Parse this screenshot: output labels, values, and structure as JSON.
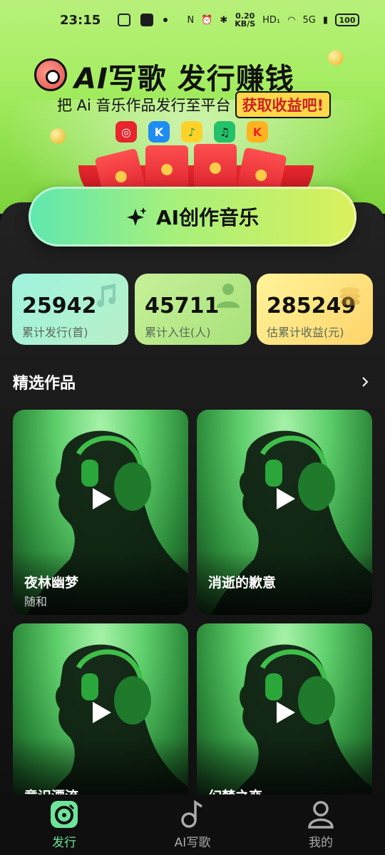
{
  "status_bar": {
    "time": "23:15",
    "speed_value": "0.20",
    "speed_unit": "KB/S",
    "hd": "HD₁",
    "network": "5G",
    "battery": "100"
  },
  "hero": {
    "title_ai": "AI",
    "title_rest": "写歌 发行赚钱",
    "subtitle": "把 Ai 音乐作品发行至平台",
    "subtitle_highlight": "获取收益吧!",
    "platforms": [
      "netease-music-icon",
      "kugou-music-icon",
      "qq-music-icon",
      "qishui-music-icon",
      "kuwo-music-icon"
    ]
  },
  "create_button": {
    "label": "AI创作音乐",
    "icon": "sparkle-icon"
  },
  "stats": [
    {
      "value": "25942",
      "label": "累计发行(首)",
      "icon": "music-note-icon"
    },
    {
      "value": "45711",
      "label": "累计入住(人)",
      "icon": "person-icon"
    },
    {
      "value": "285249",
      "label": "估累计收益(元)",
      "icon": "coins-icon"
    }
  ],
  "featured": {
    "title": "精选作品",
    "items": [
      {
        "title": "夜林幽梦",
        "artist": "随和"
      },
      {
        "title": "消逝的歉意",
        "artist": ""
      },
      {
        "title": "意识漂流",
        "artist": ""
      },
      {
        "title": "幻梦之恋",
        "artist": ""
      }
    ]
  },
  "bottom_nav": {
    "items": [
      {
        "label": "发行",
        "icon": "vinyl-icon",
        "active": true
      },
      {
        "label": "AI写歌",
        "icon": "music-note-icon",
        "active": false
      },
      {
        "label": "我的",
        "icon": "user-icon",
        "active": false
      }
    ]
  },
  "colors": {
    "accent_green": "#6ee39a",
    "hero_green": "#a7ee64",
    "panel_dark": "#141414",
    "highlight_yellow": "#ffd84a"
  }
}
